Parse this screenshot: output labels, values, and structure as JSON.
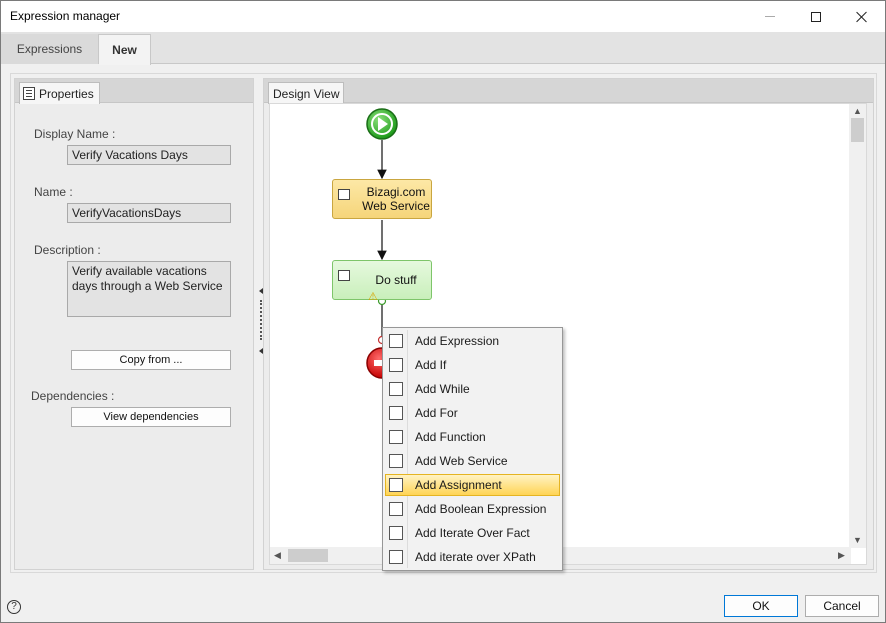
{
  "window": {
    "title": "Expression manager"
  },
  "tabs": [
    {
      "label": "Expressions",
      "active": false
    },
    {
      "label": "New",
      "active": true
    }
  ],
  "properties": {
    "panel_title": "Properties",
    "display_name_label": "Display Name :",
    "display_name_value": "Verify Vacations Days",
    "name_label": "Name :",
    "name_value": "VerifyVacationsDays",
    "description_label": "Description :",
    "description_value": "Verify available vacations days through a Web Service",
    "copy_from_label": "Copy from ...",
    "dependencies_label": "Dependencies :",
    "view_dependencies_label": "View dependencies"
  },
  "design_view": {
    "panel_title": "Design View",
    "nodes": [
      {
        "type": "start"
      },
      {
        "type": "task",
        "label_line1": "Bizagi.com",
        "label_line2": "Web Service",
        "color": "#f5d57a"
      },
      {
        "type": "task",
        "label_line1": "Do stuff",
        "color": "#c9efbb",
        "warning": true
      },
      {
        "type": "end"
      }
    ]
  },
  "context_menu": {
    "items": [
      {
        "label": "Add Expression",
        "icon": "expression-icon"
      },
      {
        "label": "Add If",
        "icon": "if-icon"
      },
      {
        "label": "Add While",
        "icon": "while-icon"
      },
      {
        "label": "Add For",
        "icon": "for-icon"
      },
      {
        "label": "Add Function",
        "icon": "function-icon"
      },
      {
        "label": "Add Web Service",
        "icon": "web-service-icon"
      },
      {
        "label": "Add Assignment",
        "icon": "assignment-icon",
        "highlighted": true
      },
      {
        "label": "Add Boolean Expression",
        "icon": "boolean-expression-icon"
      },
      {
        "label": "Add Iterate Over Fact",
        "icon": "iterate-fact-icon"
      },
      {
        "label": "Add iterate over XPath",
        "icon": "iterate-xpath-icon"
      }
    ]
  },
  "footer": {
    "help_label": "?",
    "ok_label": "OK",
    "cancel_label": "Cancel"
  }
}
